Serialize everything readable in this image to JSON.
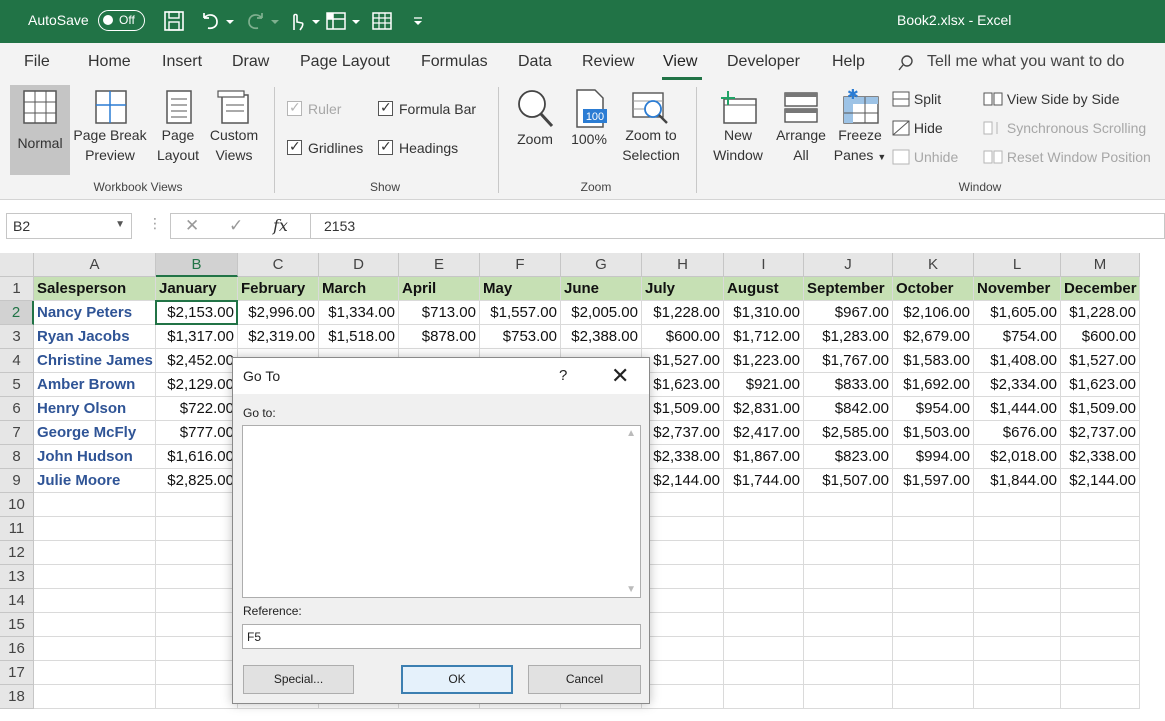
{
  "titlebar": {
    "autosave_label": "AutoSave",
    "toggle_state": "Off",
    "window_title": "Book2.xlsx  -  Excel"
  },
  "tabs": {
    "file": "File",
    "home": "Home",
    "insert": "Insert",
    "draw": "Draw",
    "page_layout": "Page Layout",
    "formulas": "Formulas",
    "data": "Data",
    "review": "Review",
    "view": "View",
    "developer": "Developer",
    "help": "Help",
    "tell_me": "Tell me what you want to do"
  },
  "ribbon": {
    "workbook_views": {
      "label": "Workbook Views",
      "normal": "Normal",
      "page_break_1": "Page Break",
      "page_break_2": "Preview",
      "page_layout_1": "Page",
      "page_layout_2": "Layout",
      "custom_1": "Custom",
      "custom_2": "Views"
    },
    "show": {
      "label": "Show",
      "ruler": "Ruler",
      "formula_bar": "Formula Bar",
      "gridlines": "Gridlines",
      "headings": "Headings"
    },
    "zoom": {
      "label": "Zoom",
      "zoom": "Zoom",
      "hundred": "100%",
      "zoom_sel_1": "Zoom to",
      "zoom_sel_2": "Selection",
      "icon_100": "100"
    },
    "window": {
      "label": "Window",
      "new_1": "New",
      "new_2": "Window",
      "arrange_1": "Arrange",
      "arrange_2": "All",
      "freeze_1": "Freeze",
      "freeze_2": "Panes",
      "split": "Split",
      "hide": "Hide",
      "unhide": "Unhide",
      "side_by_side": "View Side by Side",
      "sync_scroll": "Synchronous Scrolling",
      "reset_pos": "Reset Window Position"
    }
  },
  "formula_bar": {
    "name_box": "B2",
    "cancel_glyph": "✕",
    "enter_glyph": "✓",
    "fx": "fx",
    "value": "2153"
  },
  "sheet": {
    "columns": [
      "A",
      "B",
      "C",
      "D",
      "E",
      "F",
      "G",
      "H",
      "I",
      "J",
      "K",
      "L",
      "M"
    ],
    "rows": [
      "1",
      "2",
      "3",
      "4",
      "5",
      "6",
      "7",
      "8",
      "9",
      "10",
      "11",
      "12",
      "13",
      "14",
      "15",
      "16",
      "17",
      "18"
    ],
    "header": [
      "Salesperson",
      "January",
      "February",
      "March",
      "April",
      "May",
      "June",
      "July",
      "August",
      "September",
      "October",
      "November",
      "December"
    ],
    "data": [
      [
        "Nancy Peters",
        "$2,153.00",
        "$2,996.00",
        "$1,334.00",
        "$713.00",
        "$1,557.00",
        "$2,005.00",
        "$1,228.00",
        "$1,310.00",
        "$967.00",
        "$2,106.00",
        "$1,605.00",
        "$1,228.00"
      ],
      [
        "Ryan Jacobs",
        "$1,317.00",
        "$2,319.00",
        "$1,518.00",
        "$878.00",
        "$753.00",
        "$2,388.00",
        "$600.00",
        "$1,712.00",
        "$1,283.00",
        "$2,679.00",
        "$754.00",
        "$600.00"
      ],
      [
        "Christine James",
        "$2,452.00",
        "",
        "",
        "",
        "",
        "",
        "$1,527.00",
        "$1,223.00",
        "$1,767.00",
        "$1,583.00",
        "$1,408.00",
        "$1,527.00"
      ],
      [
        "Amber Brown",
        "$2,129.00",
        "",
        "",
        "",
        "",
        "",
        "$1,623.00",
        "$921.00",
        "$833.00",
        "$1,692.00",
        "$2,334.00",
        "$1,623.00"
      ],
      [
        "Henry Olson",
        "$722.00",
        "",
        "",
        "",
        "",
        "",
        "$1,509.00",
        "$2,831.00",
        "$842.00",
        "$954.00",
        "$1,444.00",
        "$1,509.00"
      ],
      [
        "George McFly",
        "$777.00",
        "",
        "",
        "",
        "",
        "",
        "$2,737.00",
        "$2,417.00",
        "$2,585.00",
        "$1,503.00",
        "$676.00",
        "$2,737.00"
      ],
      [
        "John Hudson",
        "$1,616.00",
        "",
        "",
        "",
        "",
        "",
        "$2,338.00",
        "$1,867.00",
        "$823.00",
        "$994.00",
        "$2,018.00",
        "$2,338.00"
      ],
      [
        "Julie Moore",
        "$2,825.00",
        "",
        "",
        "",
        "",
        "",
        "$2,144.00",
        "$1,744.00",
        "$1,507.00",
        "$1,597.00",
        "$1,844.00",
        "$2,144.00"
      ]
    ]
  },
  "dialog": {
    "title": "Go To",
    "help": "?",
    "close": "✕",
    "goto_label": "Go to:",
    "reference_label": "Reference:",
    "reference_value": "F5",
    "special": "Special...",
    "ok": "OK",
    "cancel": "Cancel"
  }
}
